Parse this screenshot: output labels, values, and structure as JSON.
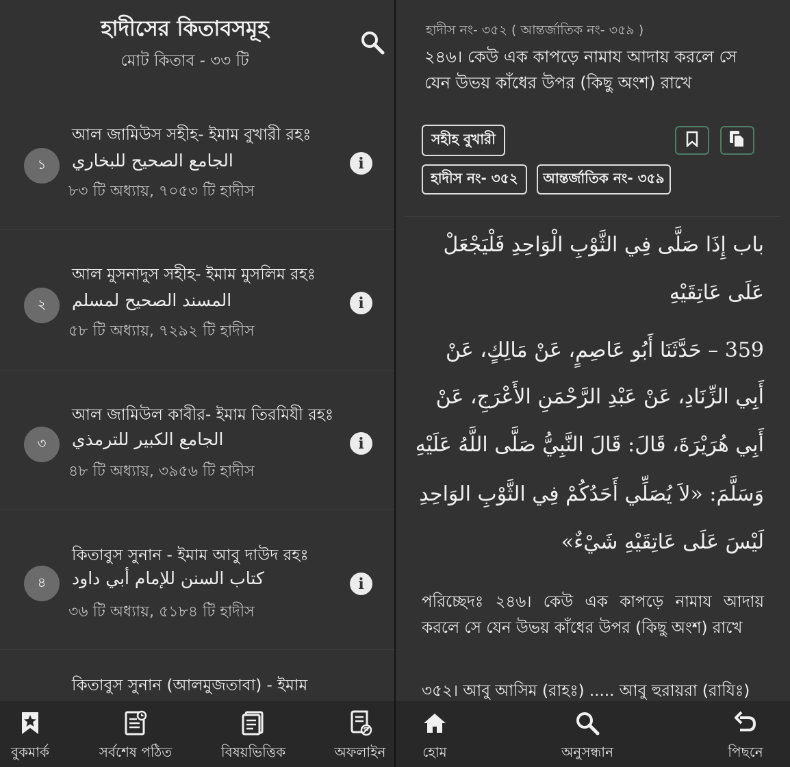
{
  "left": {
    "title": "হাদীসের কিতাবসমূহ",
    "subtitle": "মোট কিতাব - ৩৩ টি",
    "books": [
      {
        "number": "১",
        "name_bn": "আল জামিউস সহীহ- ইমাম বুখারী রহঃ",
        "name_ar": "الجامع الصحيح للبخاري",
        "stats": "৮৩ টি অধ্যায়,  ৭০৫৩ টি হাদীস"
      },
      {
        "number": "২",
        "name_bn": "আল মুসনাদুস সহীহ- ইমাম মুসলিম রহঃ",
        "name_ar": "المسند الصحيح لمسلم",
        "stats": "৫৮ টি অধ্যায়,  ৭২৯২ টি হাদীস"
      },
      {
        "number": "৩",
        "name_bn": "আল জামিউল কাবীর- ইমাম তিরমিযী রহঃ",
        "name_ar": "الجامع الكبير للترمذي",
        "stats": "৪৮ টি অধ্যায়,  ৩৯৫৬ টি হাদীস"
      },
      {
        "number": "৪",
        "name_bn": "কিতাবুস সুনান - ইমাম আবু দাউদ রহঃ",
        "name_ar": "كتاب السنن للإمام أبي داود",
        "stats": "৩৬ টি অধ্যায়,  ৫১৮৪ টি হাদীস"
      },
      {
        "number": "",
        "name_bn": "কিতাবুস সুনান (আলমুজতাবা) - ইমাম",
        "name_ar": "",
        "stats": ""
      }
    ],
    "nav": [
      {
        "label": "বুকমার্ক",
        "icon": "bookmark-star-icon"
      },
      {
        "label": "সর্বশেষ পঠিত",
        "icon": "recent-document-icon"
      },
      {
        "label": "বিষয়ভিত্তিক",
        "icon": "topic-books-icon"
      },
      {
        "label": "অফলাইন",
        "icon": "offline-book-icon"
      }
    ]
  },
  "right": {
    "meta": "হাদীস নং- ৩৫২   ( আন্তর্জাতিক নং- ৩৫৯ )",
    "heading": "২৪৬। কেউ এক কাপড়ে নামায আদায় করলে সে যেন উভয় কাঁধের উপর (কিছু অংশ) রাখে",
    "chip_book": "সহীহ বুখারী",
    "chip_hadith": "হাদীস নং- ৩৫২",
    "chip_intl": "আন্তর্জাতিক নং- ৩৫৯",
    "arabic_lines": [
      "باب إِذَا صَلَّى فِي الثَّوْبِ الْوَاحِدِ فَلْيَجْعَلْ",
      "عَلَى عَاتِقَيْهِ",
      "359 – حَدَّثَنَا أَبُو عَاصِمٍ، عَنْ مَالِكٍ، عَنْ",
      "أَبِي الزِّنَادِ، عَنْ عَبْدِ الرَّحْمَنِ الأَعْرَجِ، عَنْ",
      "أَبِي هُرَيْرَةَ، قَالَ: قَالَ النَّبِيُّ صَلَّى اللَّهُ عَلَيْهِ",
      "وَسَلَّمَ: «لاَ يُصَلِّي أَحَدُكُمْ فِي الثَّوْبِ الوَاحِدِ",
      "لَيْسَ عَلَى عَاتِقَيْهِ شَيْءٌ»"
    ],
    "chapter_text": "পরিচ্ছেদঃ ২৪৬। কেউ এক কাপড়ে নামায আদায় করলে সে যেন উভয় কাঁধের উপর (কিছু অংশ) রাখে",
    "narrator_text": "৩৫২। আবু আসিম (রাহঃ) ..... আবু হুরায়রা (রাযিঃ)",
    "nav": [
      {
        "label": "হোম",
        "icon": "home-icon"
      },
      {
        "label": "অনুসন্ধান",
        "icon": "search-icon"
      },
      {
        "label": "পিছনে",
        "icon": "undo-back-icon"
      }
    ]
  },
  "colors": {
    "background": "#323232",
    "nav_background": "#282828",
    "accent_green": "#4e7d66",
    "badge_grey": "#6b6b6b"
  }
}
